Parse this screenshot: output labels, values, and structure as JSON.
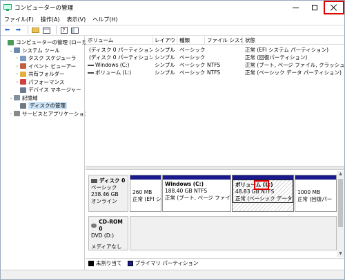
{
  "window": {
    "title": "コンピューターの管理",
    "controls": {
      "minimize": "—",
      "maximize": "☐",
      "close": "✕"
    }
  },
  "menu": [
    "ファイル(F)",
    "操作(A)",
    "表示(V)",
    "ヘルプ(H)"
  ],
  "toolbar_icons": [
    "back-arrow-icon",
    "forward-arrow-icon",
    "folder-up-icon",
    "list-view-icon",
    "help-icon",
    "panel-icon"
  ],
  "toolbar_glyphs": {
    "back": "⬅",
    "forward": "➡",
    "help": "?"
  },
  "tree": [
    {
      "label": "コンピューターの管理 (ローカル)",
      "level": 0,
      "arrow": "",
      "icon_color": "#4a9a5a"
    },
    {
      "label": "システム ツール",
      "level": 1,
      "arrow": "⌄",
      "icon_color": "#6a8ab0"
    },
    {
      "label": "タスク スケジューラ",
      "level": 2,
      "arrow": "›",
      "icon_color": "#7a9ac0"
    },
    {
      "label": "イベント ビューアー",
      "level": 2,
      "arrow": "›",
      "icon_color": "#c06040"
    },
    {
      "label": "共有フォルダー",
      "level": 2,
      "arrow": "›",
      "icon_color": "#e0b040"
    },
    {
      "label": "パフォーマンス",
      "level": 2,
      "arrow": "›",
      "icon_color": "#d04040"
    },
    {
      "label": "デバイス マネージャー",
      "level": 2,
      "arrow": "",
      "icon_color": "#6a7a90"
    },
    {
      "label": "記憶域",
      "level": 1,
      "arrow": "⌄",
      "icon_color": "#8090a0"
    },
    {
      "label": "ディスクの管理",
      "level": 2,
      "arrow": "",
      "icon_color": "#707880",
      "selected": true
    },
    {
      "label": "サービスとアプリケーション",
      "level": 1,
      "arrow": "›",
      "icon_color": "#8a8a8a"
    }
  ],
  "volume_columns": [
    "ボリューム",
    "レイアウト",
    "種類",
    "ファイル システム",
    "状態"
  ],
  "volumes": [
    {
      "name": "(ディスク 0 パーティション 1)",
      "layout": "シンプル",
      "type": "ベーシック",
      "fs": "",
      "status": "正常 (EFI システム パーティション)"
    },
    {
      "name": "(ディスク 0 パーティション 4)",
      "layout": "シンプル",
      "type": "ベーシック",
      "fs": "",
      "status": "正常 (回復パーティション)"
    },
    {
      "name": "Windows (C:)",
      "layout": "シンプル",
      "type": "ベーシック",
      "fs": "NTFS",
      "status": "正常 (ブート, ページ ファイル, クラッシュ ダンプ, ベーシ"
    },
    {
      "name": "ボリューム (L:)",
      "layout": "シンプル",
      "type": "ベーシック",
      "fs": "NTFS",
      "status": "正常 (ベーシック データ パーティション)"
    }
  ],
  "disks": [
    {
      "name": "ディスク 0",
      "type": "ベーシック",
      "size": "238.46 GB",
      "state": "オンライン",
      "partitions": [
        {
          "name": "",
          "size": "260 MB",
          "status": "正常 (EFI シ"
        },
        {
          "name": "Windows  (C:)",
          "size": "188.40 GB NTFS",
          "status": "正常 (ブート, ページ ファイル, ク"
        },
        {
          "name": "ボリューム (L:)",
          "size": "48.83 GB NTFS",
          "status": "正常 (ベーシック データ パー",
          "selected": true
        },
        {
          "name": "",
          "size": "1000 MB",
          "status": "正常 (回復パー"
        }
      ]
    },
    {
      "name": "CD-ROM 0",
      "type": "DVD (D:)",
      "size": "",
      "state": "メディアなし",
      "partitions": []
    }
  ],
  "legend": [
    {
      "label": "未割り当て",
      "color": "#000000"
    },
    {
      "label": "プライマリ パーティション",
      "color": "#1a1a8c"
    }
  ],
  "scroll_glyphs": {
    "up": "▲",
    "down": "▼"
  }
}
